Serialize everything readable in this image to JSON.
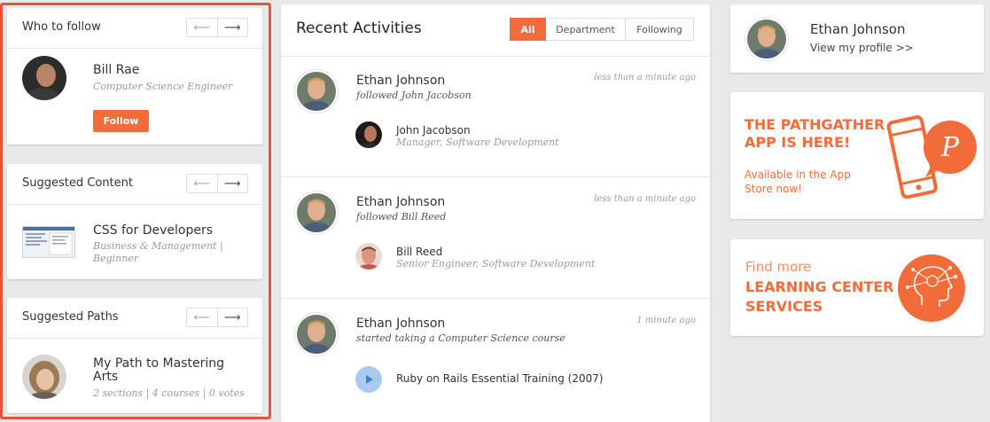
{
  "who_to_follow": {
    "title": "Who to follow",
    "prev_arrow": "⟵",
    "next_arrow": "⟶",
    "person": {
      "name": "Bill Rae",
      "role": "Computer Science Engineer"
    },
    "follow_label": "Follow"
  },
  "suggested_content": {
    "title": "Suggested Content",
    "prev_arrow": "⟵",
    "next_arrow": "⟶",
    "item": {
      "title": "CSS for Developers",
      "meta_line1": "Business & Management |",
      "meta_line2": "Beginner"
    }
  },
  "suggested_paths": {
    "title": "Suggested Paths",
    "prev_arrow": "⟵",
    "next_arrow": "⟶",
    "item": {
      "title_line1": "My Path to Mastering",
      "title_line2": "Arts",
      "meta": "2 sections | 4 courses | 0 votes"
    }
  },
  "recent": {
    "title": "Recent Activities",
    "filters": {
      "all": "All",
      "department": "Department",
      "following": "Following"
    },
    "activities": [
      {
        "actor": "Ethan Johnson",
        "verb": "followed John Jacobson",
        "time": "less than a minute ago",
        "target_name": "John Jacobson",
        "target_role": "Manager, Software Development"
      },
      {
        "actor": "Ethan Johnson",
        "verb": "followed Bill Reed",
        "time": "less than a minute ago",
        "target_name": "Bill Reed",
        "target_role": "Senior Engineer, Software Development"
      },
      {
        "actor": "Ethan Johnson",
        "verb": "started taking a Computer Science course",
        "time": "1 minute ago",
        "course": "Ruby on Rails Essential Training (2007)"
      }
    ]
  },
  "profile": {
    "name": "Ethan Johnson",
    "link": "View my profile >>"
  },
  "app_promo": {
    "headline_line1": "THE PATHGATHER",
    "headline_line2": "APP IS HERE!",
    "sub_line1": "Available in the App",
    "sub_line2": "Store now!",
    "badge_letter": "P"
  },
  "learning_center": {
    "line1": "Find more",
    "line2": "LEARNING CENTER",
    "line3": "SERVICES"
  },
  "colors": {
    "accent": "#f26b3a",
    "highlight_border": "#e5533f",
    "play": "#a9c9ee"
  }
}
